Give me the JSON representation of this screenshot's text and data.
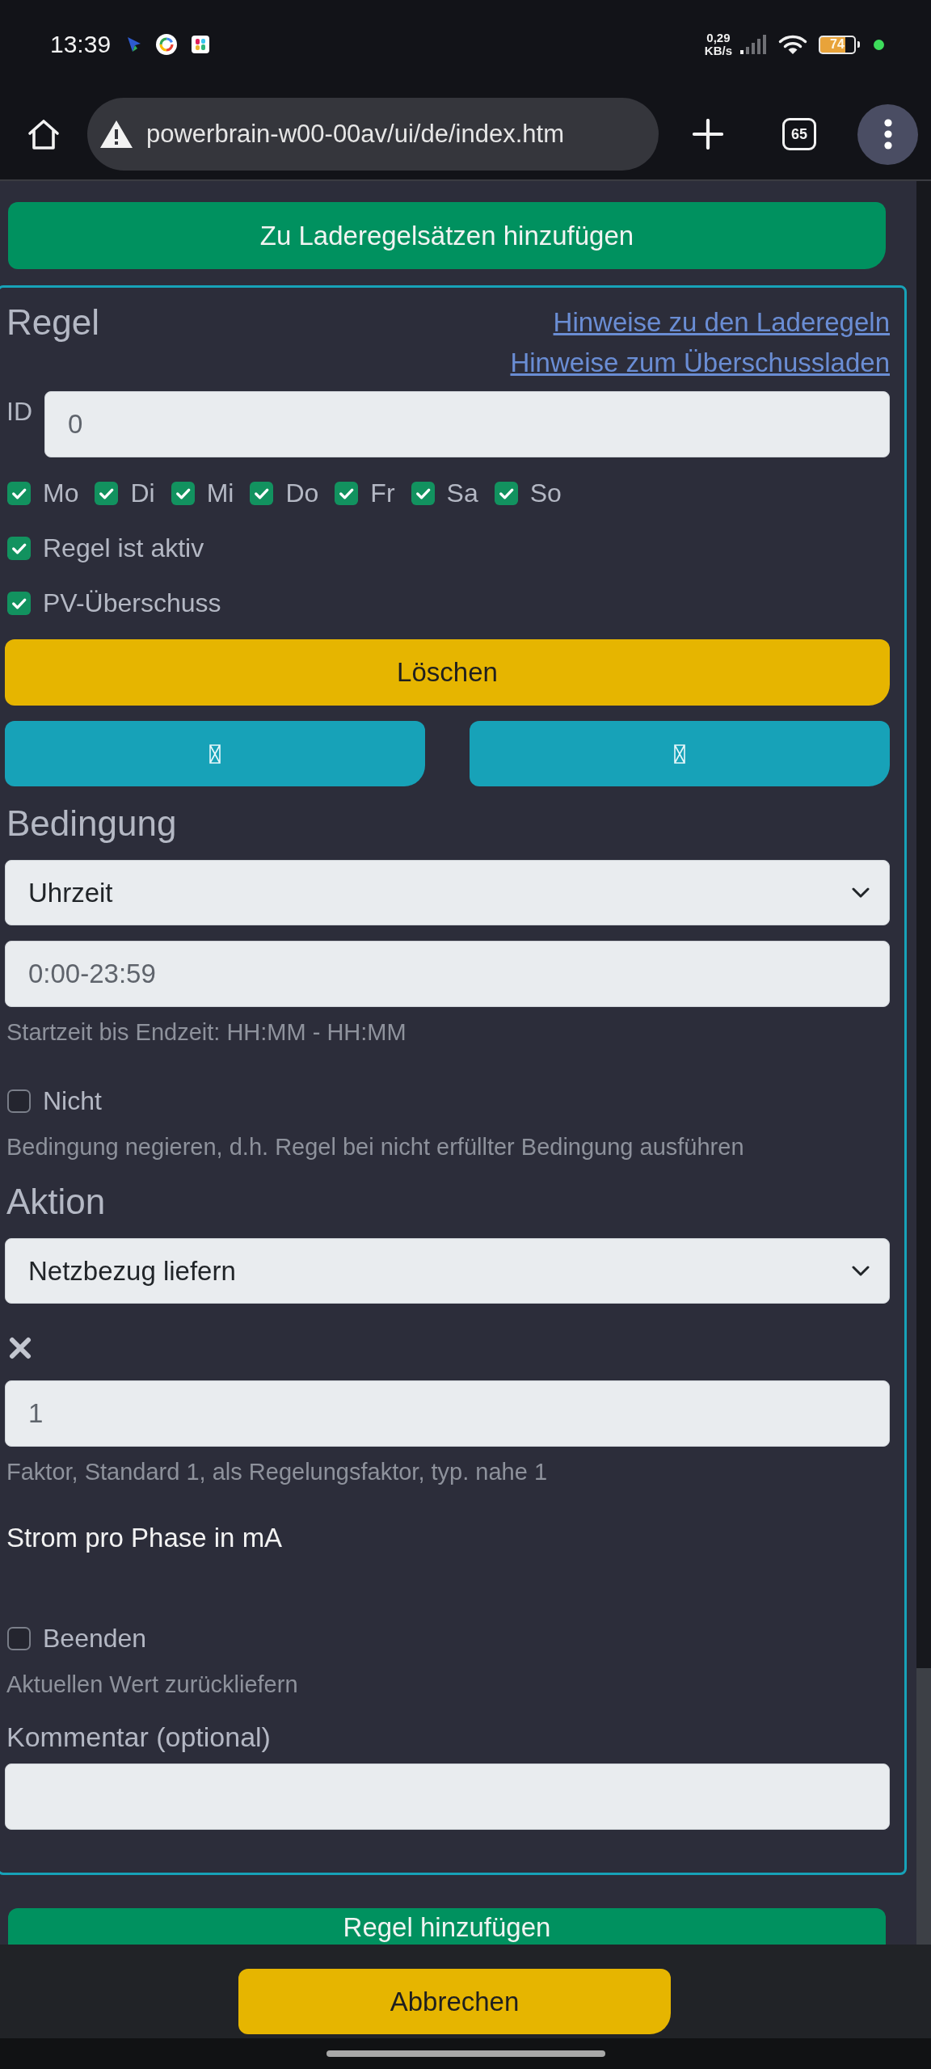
{
  "status_bar": {
    "time": "13:39",
    "network_speed": {
      "value": "0,29",
      "unit": "KB/s"
    },
    "battery": "74"
  },
  "browser": {
    "url": "powerbrain-w00-00av/ui/de/index.htm",
    "tab_count": "65"
  },
  "top_button": "Zu Laderegelsätzen hinzufügen",
  "rule": {
    "title": "Regel",
    "links": [
      "Hinweise zu den Laderegeln",
      "Hinweise zum Überschussladen"
    ],
    "id_field": {
      "label": "ID",
      "placeholder": "0"
    },
    "days": [
      {
        "label": "Mo",
        "checked": true
      },
      {
        "label": "Di",
        "checked": true
      },
      {
        "label": "Mi",
        "checked": true
      },
      {
        "label": "Do",
        "checked": true
      },
      {
        "label": "Fr",
        "checked": true
      },
      {
        "label": "Sa",
        "checked": true
      },
      {
        "label": "So",
        "checked": true
      }
    ],
    "options": [
      {
        "label": "Regel ist aktiv",
        "checked": true
      },
      {
        "label": "PV-Überschuss",
        "checked": true
      }
    ],
    "delete_button": "Löschen"
  },
  "condition": {
    "title": "Bedingung",
    "type_select": "Uhrzeit",
    "time_field": {
      "placeholder": "0:00-23:59"
    },
    "time_hint": "Startzeit bis Endzeit: HH:MM - HH:MM",
    "negate": {
      "label": "Nicht",
      "checked": false
    },
    "negate_hint": "Bedingung negieren, d.h. Regel bei nicht erfüllter Bedingung ausführen"
  },
  "action": {
    "title": "Aktion",
    "type_select": "Netzbezug liefern",
    "factor_field": {
      "placeholder": "1"
    },
    "factor_hint": "Faktor, Standard 1, als Regelungsfaktor, typ. nahe 1",
    "unit_label": "Strom pro Phase in mA",
    "end": {
      "label": "Beenden",
      "checked": false
    },
    "end_hint": "Aktuellen Wert zurückliefern"
  },
  "comment": {
    "label": "Kommentar (optional)"
  },
  "add_button": "Regel hinzufügen",
  "cancel_button": "Abbrechen"
}
